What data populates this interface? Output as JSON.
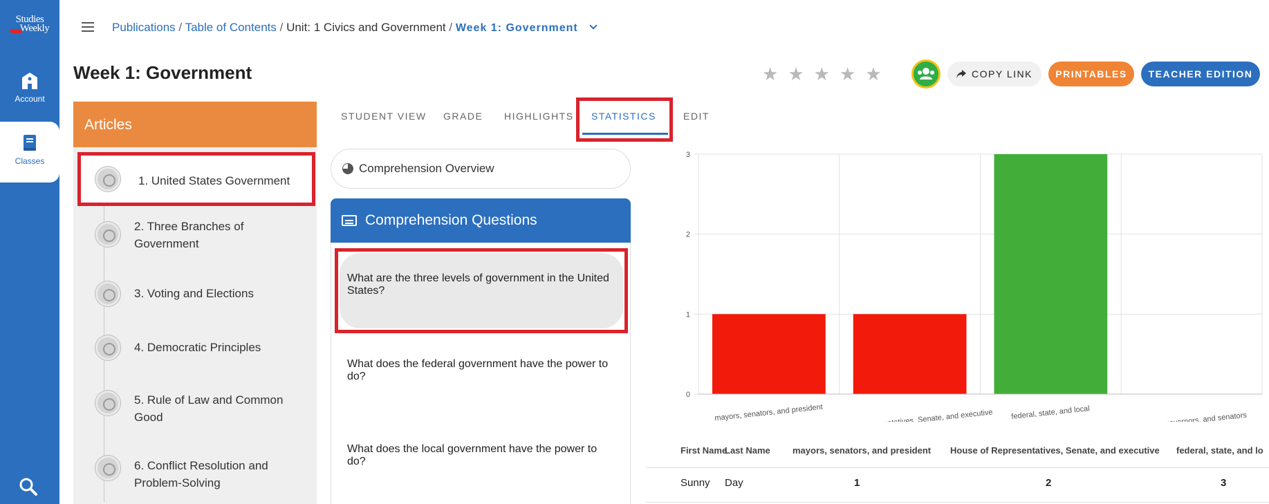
{
  "brand": {
    "line1": "Studies",
    "line2": "Weekly"
  },
  "rail": {
    "account_label": "Account",
    "classes_label": "Classes"
  },
  "breadcrumb": {
    "publications": "Publications",
    "sep": "/",
    "toc": "Table of Contents",
    "unit": "Unit: 1 Civics and Government",
    "current": "Week 1: Government"
  },
  "page_title": "Week 1: Government",
  "rating": {
    "stars": 5,
    "filled": 0
  },
  "buttons": {
    "copy_link": "COPY LINK",
    "printables": "PRINTABLES",
    "teacher_edition": "TEACHER EDITION"
  },
  "articles": {
    "heading": "Articles",
    "items": [
      {
        "label": "1. United States Government",
        "selected": true
      },
      {
        "label": "2. Three Branches of Government"
      },
      {
        "label": "3. Voting and Elections"
      },
      {
        "label": "4. Democratic Principles"
      },
      {
        "label": "5. Rule of Law and Common Good"
      },
      {
        "label": "6. Conflict Resolution and Problem-Solving"
      }
    ]
  },
  "tabs": {
    "student_view": "STUDENT VIEW",
    "grade": "GRADE",
    "highlights": "HIGHLIGHTS",
    "statistics": "STATISTICS",
    "edit": "EDIT",
    "active": "statistics"
  },
  "comprehension": {
    "overview": "Comprehension Overview",
    "heading": "Comprehension Questions",
    "questions": [
      "What are the three levels of government in the United States?",
      "What does the federal government have the power to do?",
      "What does the local government have the power to do?"
    ]
  },
  "chart_data": {
    "type": "bar",
    "categories": [
      "mayors, senators, and president",
      "House of Representatives, Senate, and executive",
      "federal, state, and local",
      "mayors, governors, and senators"
    ],
    "values": [
      1,
      1,
      3,
      0
    ],
    "bar_colors": [
      "#f21a0a",
      "#f21a0a",
      "#43ad3a",
      "#f21a0a"
    ],
    "ylim": [
      0,
      3
    ],
    "yticks": [
      "0",
      "1",
      "2",
      "3"
    ],
    "grid": true
  },
  "stats_table": {
    "headers": [
      "First Name",
      "Last Name",
      "mayors, senators, and president",
      "House of Representatives, Senate, and executive",
      "federal, state, and lo"
    ],
    "rows": [
      [
        "Sunny",
        "Day",
        "1",
        "2",
        "3"
      ]
    ]
  },
  "colors": {
    "brand_blue": "#2b6fbe",
    "orange": "#ea8a40",
    "highlight_red": "#d9232d"
  }
}
